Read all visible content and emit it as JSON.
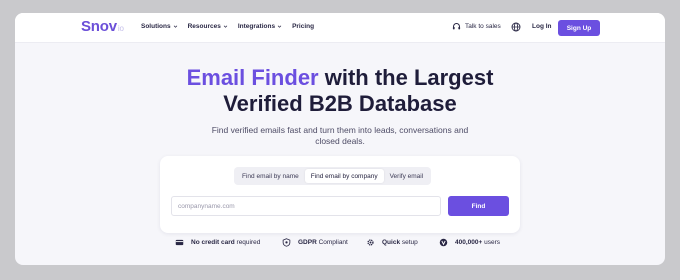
{
  "nav": {
    "logo_main": "Snov",
    "logo_suffix": "io",
    "menu": [
      {
        "label": "Solutions",
        "icon": "chevron-down-icon"
      },
      {
        "label": "Resources",
        "icon": "chevron-down-icon"
      },
      {
        "label": "Integrations",
        "icon": "chevron-down-icon"
      },
      {
        "label": "Pricing"
      }
    ],
    "talk_to_sales": "Talk to sales",
    "login": "Log In",
    "signup": "Sign Up"
  },
  "hero": {
    "title_accent": "Email Finder",
    "title_rest_line1": " with the Largest",
    "title_line2": "Verified B2B Database",
    "subtitle": "Find verified emails fast and turn them into leads, conversations and closed deals."
  },
  "finder": {
    "tabs": [
      "Find email by name",
      "Find email by company",
      "Verify email"
    ],
    "active_tab": 1,
    "input_placeholder": "companyname.com",
    "input_value": "",
    "find_button": "Find"
  },
  "features": [
    {
      "bold": "No credit card",
      "rest": " required",
      "icon": "credit-card-icon"
    },
    {
      "bold": "GDPR",
      "rest": " Compliant",
      "icon": "shield-icon"
    },
    {
      "bold": "Quick",
      "rest": " setup",
      "icon": "gear-icon"
    },
    {
      "bold": "400,000+",
      "rest": " users",
      "icon": "users-icon"
    }
  ],
  "colors": {
    "accent": "#6b4fe0",
    "text_dark": "#1f1d3a",
    "background": "#f6f6fa"
  }
}
